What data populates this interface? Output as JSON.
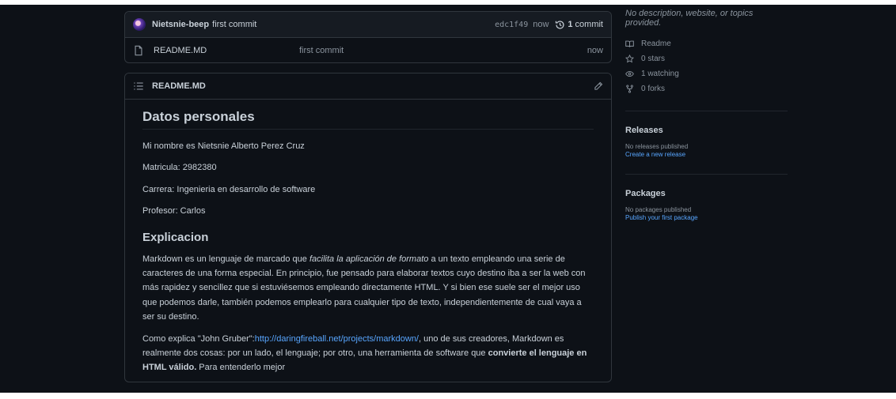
{
  "commit": {
    "author": "Nietsnie-beep",
    "message": "first commit",
    "sha": "edc1f49",
    "time": "now",
    "count": "1",
    "count_label": "commit"
  },
  "files": [
    {
      "name": "README.MD",
      "message": "first commit",
      "time": "now"
    }
  ],
  "readme": {
    "filename": "README.MD",
    "h_datos": "Datos personales",
    "p_nombre": "Mi nombre es Nietsnie Alberto Perez Cruz",
    "p_matricula": "Matricula: 2982380",
    "p_carrera": "Carrera: Ingenieria en desarrollo de software",
    "p_profesor": "Profesor: Carlos",
    "h_explicacion": "Explicacion",
    "p1_a": "Markdown es un lenguaje de marcado que ",
    "p1_em": "facilita la aplicación de formato",
    "p1_b": " a un texto empleando una serie de caracteres de una forma especial. En principio, fue pensado para elaborar textos cuyo destino iba a ser la web con más rapidez y sencillez que si estuviésemos empleando directamente HTML. Y si bien ese suele ser el mejor uso que podemos darle, también podemos emplearlo para cualquier tipo de texto, independientemente de cual vaya a ser su destino.",
    "p2_a": "Como explica \"John Gruber\":",
    "p2_link": "http://daringfireball.net/projects/markdown/",
    "p2_b": ", uno de sus creadores, Markdown es realmente dos cosas: por un lado, el lenguaje; por otro, una herramienta de software que ",
    "p2_strong": "convierte el lenguaje en HTML válido.",
    "p2_c": " Para entenderlo mejor"
  },
  "sidebar": {
    "description": "No description, website, or topics provided.",
    "readme": "Readme",
    "stars": "0 stars",
    "watching": "1 watching",
    "forks": "0 forks",
    "releases_title": "Releases",
    "releases_empty": "No releases published",
    "releases_link": "Create a new release",
    "packages_title": "Packages",
    "packages_empty": "No packages published",
    "packages_link": "Publish your first package"
  },
  "colors": {
    "background": "#0d1117",
    "panel": "#161b22",
    "border": "#30363d",
    "link": "#58a6ff",
    "muted": "#8b949e",
    "text": "#c9d1d9"
  }
}
